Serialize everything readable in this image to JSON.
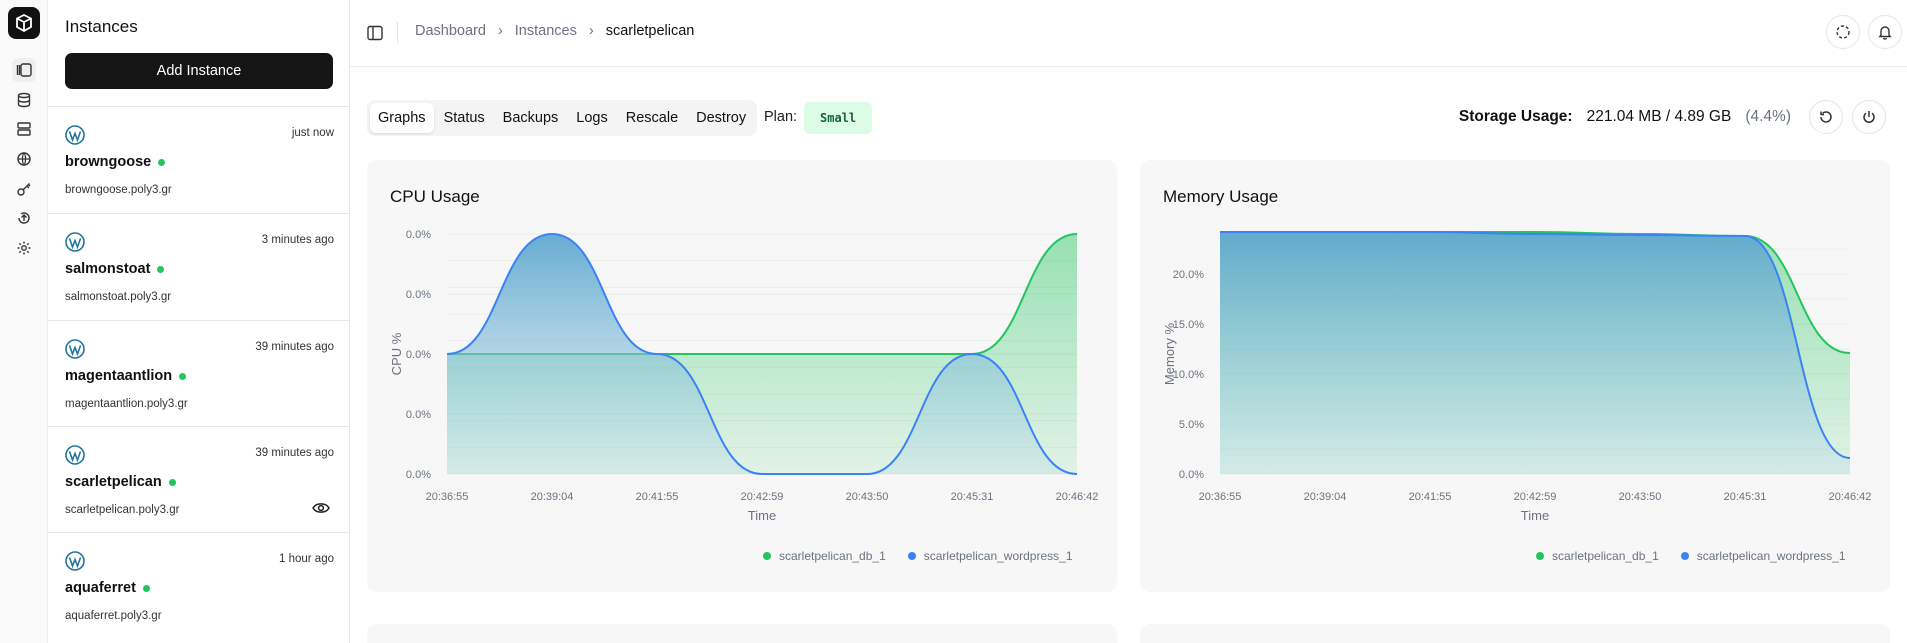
{
  "sidebar_title": "Instances",
  "add_button": "Add Instance",
  "instances": [
    {
      "name": "browngoose",
      "time": "just now",
      "domain": "browngoose.poly3.gr"
    },
    {
      "name": "salmonstoat",
      "time": "3 minutes ago",
      "domain": "salmonstoat.poly3.gr"
    },
    {
      "name": "magentaantlion",
      "time": "39 minutes ago",
      "domain": "magentaantlion.poly3.gr"
    },
    {
      "name": "scarletpelican",
      "time": "39 minutes ago",
      "domain": "scarletpelican.poly3.gr"
    },
    {
      "name": "aquaferret",
      "time": "1 hour ago",
      "domain": "aquaferret.poly3.gr"
    }
  ],
  "breadcrumb": {
    "dashboard": "Dashboard",
    "instances": "Instances",
    "current": "scarletpelican"
  },
  "tabs": [
    "Graphs",
    "Status",
    "Backups",
    "Logs",
    "Rescale",
    "Destroy"
  ],
  "plan": {
    "label": "Plan:",
    "value": "Small"
  },
  "storage": {
    "label": "Storage Usage:",
    "value": "221.04 MB / 4.89 GB",
    "percent": "(4.4%)"
  },
  "colors": {
    "db": "#22c55e",
    "wordpress": "#3b82f6",
    "accent": "#151515"
  },
  "chart_data": [
    {
      "type": "area",
      "title": "CPU Usage",
      "xlabel": "Time",
      "ylabel": "CPU %",
      "x_ticks": [
        "20:36:55",
        "20:39:04",
        "20:41:55",
        "20:42:59",
        "20:43:50",
        "20:45:31",
        "20:46:42"
      ],
      "y_ticks": [
        "0.0%",
        "0.0%",
        "0.0%",
        "0.0%",
        "0.0%"
      ],
      "series": [
        {
          "name": "scarletpelican_db_1",
          "values": [
            0.5,
            0.5,
            0.5,
            0.5,
            0.5,
            0.5,
            1.0
          ]
        },
        {
          "name": "scarletpelican_wordpress_1",
          "values": [
            0.5,
            1.0,
            0.5,
            0.0,
            0.0,
            0.5,
            0.0
          ]
        }
      ]
    },
    {
      "type": "area",
      "title": "Memory Usage",
      "xlabel": "Time",
      "ylabel": "Memory %",
      "x_ticks": [
        "20:36:55",
        "20:39:04",
        "20:41:55",
        "20:42:59",
        "20:43:50",
        "20:45:31",
        "20:46:42"
      ],
      "y_ticks": [
        "0.0%",
        "5.0%",
        "10.0%",
        "15.0%",
        "20.0%"
      ],
      "ylim": [
        0,
        24
      ],
      "series": [
        {
          "name": "scarletpelican_db_1",
          "values": [
            24.2,
            24.2,
            24.2,
            24.2,
            24.0,
            23.8,
            12.1
          ]
        },
        {
          "name": "scarletpelican_wordpress_1",
          "values": [
            24.2,
            24.2,
            24.2,
            24.0,
            23.9,
            23.8,
            1.6
          ]
        }
      ]
    }
  ]
}
